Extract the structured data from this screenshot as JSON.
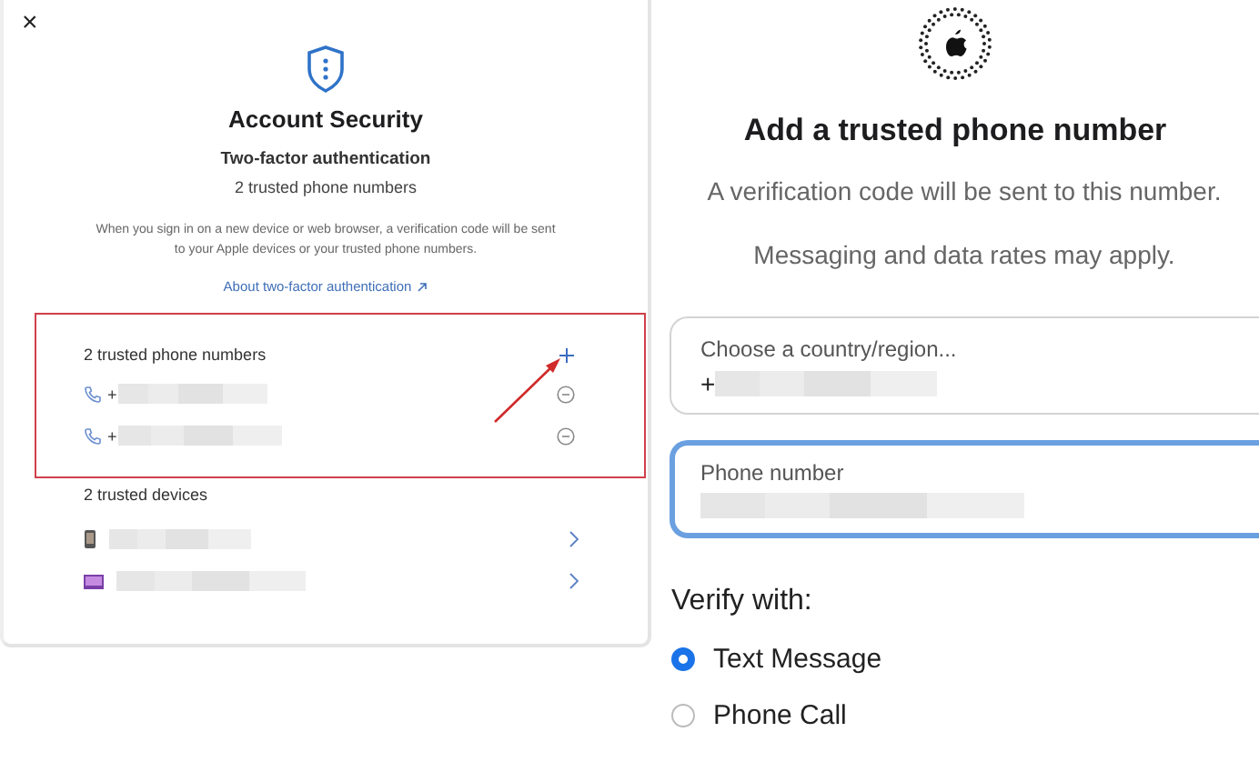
{
  "account_panel": {
    "close": "×",
    "title": "Account Security",
    "subtitle": "Two-factor authentication",
    "summary": "2 trusted phone numbers",
    "description": "When you sign in on a new device or web browser, a verification code will be sent to your Apple devices or your trusted phone numbers.",
    "link": "About two-factor authentication",
    "phone_section": {
      "heading": "2 trusted phone numbers",
      "highlighted": true,
      "phones": [
        {
          "prefix": "+"
        },
        {
          "prefix": "+"
        }
      ]
    },
    "devices_section": {
      "heading": "2 trusted devices",
      "devices": [
        {
          "kind": "phone"
        },
        {
          "kind": "laptop"
        }
      ]
    }
  },
  "add_number_panel": {
    "title": "Add a trusted phone number",
    "lines": [
      "A verification code will be sent to this number.",
      "Messaging and data rates may apply."
    ],
    "fields": [
      {
        "label": "Choose a country/region...",
        "value": "+",
        "focused": false
      },
      {
        "label": "Phone number",
        "focused": true
      }
    ],
    "verify_label": "Verify with:",
    "options": [
      {
        "label": "Text Message",
        "selected": true
      },
      {
        "label": "Phone Call",
        "selected": false
      }
    ]
  }
}
